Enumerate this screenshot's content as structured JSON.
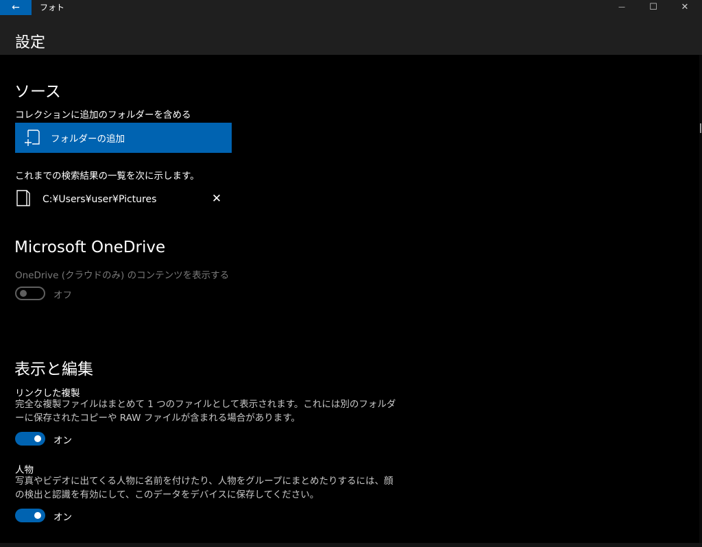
{
  "window": {
    "app_title": "フォト",
    "back_icon": "←",
    "minimize_icon": "—",
    "maximize_icon": "☐",
    "close_icon": "✕"
  },
  "page_title": "設定",
  "sources": {
    "heading": "ソース",
    "include_label": "コレクションに追加のフォルダーを含める",
    "add_folder_button": "フォルダーの追加",
    "results_label": "これまでの検索結果の一覧を次に示します。",
    "folders": [
      {
        "path": "C:¥Users¥user¥Pictures",
        "remove_icon": "✕"
      }
    ]
  },
  "onedrive": {
    "heading": "Microsoft OneDrive",
    "description": "OneDrive (クラウドのみ) のコンテンツを表示する",
    "toggle_state": "off",
    "toggle_label": "オフ"
  },
  "viewing": {
    "heading": "表示と編集",
    "linked_title": "リンクした複製",
    "linked_desc": "完全な複製ファイルはまとめて 1 つのファイルとして表示されます。これには別のフォルダーに保存されたコピーや RAW ファイルが含まれる場合があります。",
    "linked_toggle_state": "on",
    "linked_toggle_label": "オン",
    "people_title": "人物",
    "people_desc": "写真やビデオに出てくる人物に名前を付けたり、人物をグループにまとめたりするには、顔の検出と認識を有効にして、このデータをデバイスに保存してください。",
    "people_toggle_state": "on",
    "people_toggle_label": "オン"
  },
  "colors": {
    "accent": "#0063b1",
    "titlebar": "#1f1f1f",
    "background": "#000000",
    "disabled_text": "#7a7a7a"
  }
}
